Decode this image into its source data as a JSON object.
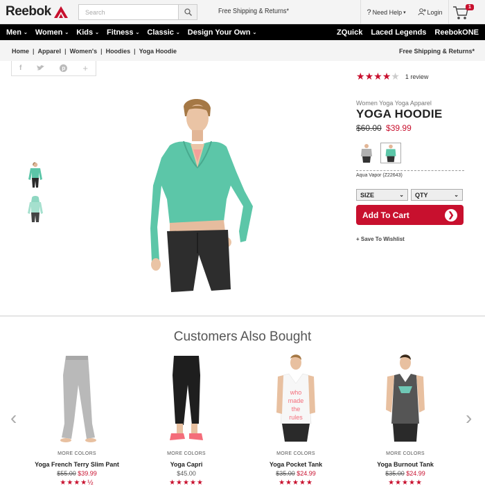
{
  "header": {
    "logo_text": "Reebok",
    "search_placeholder": "Search",
    "shipping_promo": "Free Shipping & Returns*",
    "need_help": "Need Help",
    "login": "Login",
    "cart_count": "1"
  },
  "nav": {
    "left": [
      "Men",
      "Women",
      "Kids",
      "Fitness",
      "Classic",
      "Design Your Own"
    ],
    "right": [
      "ZQuick",
      "Laced Legends",
      "ReebokONE"
    ]
  },
  "breadcrumb": [
    "Home",
    "Apparel",
    "Women's",
    "Hoodies",
    "Yoga Hoodie"
  ],
  "breadcrumb_shipping": "Free Shipping & Returns*",
  "product": {
    "rating": 4,
    "rating_max": 5,
    "review_count": "1 review",
    "category": "Women Yoga Yoga Apparel",
    "title": "YOGA HOODIE",
    "price_old": "$60.00",
    "price_new": "$39.99",
    "color_name": "Aqua Vapor (Z22643)",
    "size_label": "SIZE",
    "qty_label": "QTY",
    "add_to_cart": "Add To Cart",
    "wishlist": "+ Save To Wishlist"
  },
  "colors": {
    "accent": "#c8102e",
    "hoodie": "#5cc6a8",
    "star_off": "#cccccc"
  },
  "also_bought": {
    "title": "Customers Also Bought",
    "items": [
      {
        "more": "MORE COLORS",
        "name": "Yoga French Terry Slim Pant",
        "old": "$55.00",
        "price": "$39.99",
        "stars": "★★★★½"
      },
      {
        "more": "MORE COLORS",
        "name": "Yoga Capri",
        "old": "",
        "price": "$45.00",
        "stars": "★★★★★"
      },
      {
        "more": "MORE COLORS",
        "name": "Yoga Pocket Tank",
        "old": "$35.00",
        "price": "$24.99",
        "stars": "★★★★★"
      },
      {
        "more": "MORE COLORS",
        "name": "Yoga Burnout Tank",
        "old": "$35.00",
        "price": "$24.99",
        "stars": "★★★★★"
      }
    ]
  },
  "tank_print": "who made the rules"
}
